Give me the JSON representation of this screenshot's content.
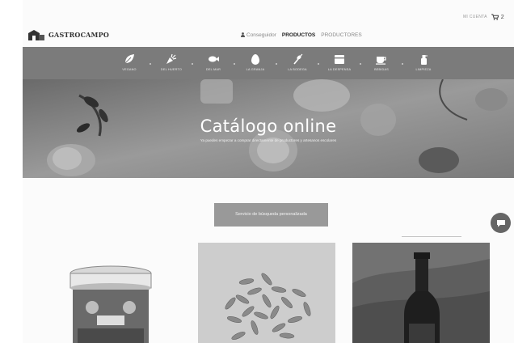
{
  "header": {
    "account_label": "MI CUENTA",
    "cart_count": "2",
    "logo_text": "GASTROCAMPO"
  },
  "nav": {
    "items": [
      {
        "label": "Conseguidor"
      },
      {
        "label": "PRODUCTOS"
      },
      {
        "label": "PRODUCTORES"
      }
    ]
  },
  "categories": [
    {
      "label": "VEGANO",
      "icon": "leaf-icon"
    },
    {
      "label": "DEL HUERTO",
      "icon": "carrot-icon"
    },
    {
      "label": "DEL MAR",
      "icon": "fish-icon"
    },
    {
      "label": "LA GRANJA",
      "icon": "egg-icon"
    },
    {
      "label": "LA BODEGA",
      "icon": "wine-icon"
    },
    {
      "label": "LA DESPENSA",
      "icon": "pantry-icon"
    },
    {
      "label": "BEBIDAS",
      "icon": "cup-icon"
    },
    {
      "label": "LIMPIEZA",
      "icon": "spray-bottle-icon"
    }
  ],
  "hero": {
    "title": "Catálogo online",
    "subtitle": "Ya puedes empezar a comprar directamente de productores y artesanos escolares"
  },
  "cta": {
    "label": "Servicio de búsqueda personalizada"
  },
  "colors": {
    "category_bar": "#7b7b7b",
    "cta_background": "#999999",
    "chat_button": "#666666"
  }
}
